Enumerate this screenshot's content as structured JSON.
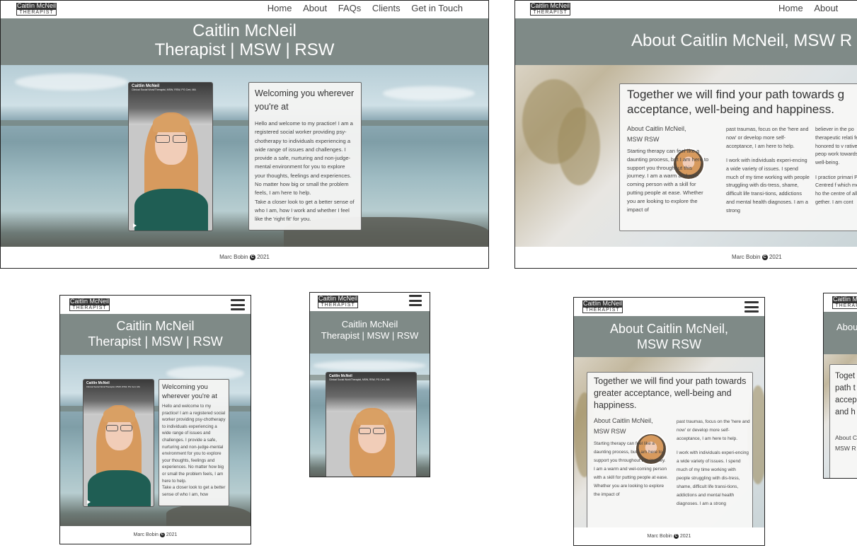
{
  "site": {
    "logo_line1": "Caitlin McNeil",
    "logo_line2": "THERAPIST",
    "footer_author": "Marc Bobin",
    "footer_year": "2021",
    "copyright_symbol": "C"
  },
  "nav": {
    "home": "Home",
    "about": "About",
    "faqs": "FAQs",
    "clients": "Clients",
    "contact": "Get in Touch"
  },
  "home": {
    "title_line1": "Caitlin McNeil",
    "title_line2": "Therapist | MSW | RSW",
    "video_name": "Caitlin McNeil",
    "video_subtitle": "Clinical Social Work/Therapist, MSW, RSW, PG Cert, MA",
    "welcome_heading": "Welcoming you wherever you're at",
    "welcome_p1": "Hello and welcome to my practice! I am a registered social worker providing psy-chotherapy to individuals experiencing a wide range of issues and challenges. I provide a safe, nurturing and non-judge-mental environment for you to explore your thoughts, feelings and experiences. No matter how big or small the problem feels, I am here to help.",
    "welcome_p2": "Take a closer look to get a better sense of who I am, how I work and whether I feel like the 'right fit' for you.",
    "welcome_p2_truncated": "Take a closer look to get a better sense of who I am, how"
  },
  "about": {
    "title_desktop": "About Caitlin McNeil, MSW R",
    "title_line1": "About Caitlin McNeil,",
    "title_line2": "MSW RSW",
    "title_partial": "Abou",
    "tagline_desktop_1": "Together we will find your path towards g",
    "tagline_desktop_2": "acceptance, well-being and happiness.",
    "tagline_full": "Together we will find your path towards greater acceptance, well-being and happiness.",
    "tagline_partial": "Toget path t accep and h",
    "subheading": "About Caitlin McNeil, MSW RSW",
    "subheading_partial": "About C MSW R",
    "col1": "Starting therapy can feel like a daunting process, but I am here to support you throughout this journey. I am a warm and wel-coming person with a skill for putting people at ease. Whether you are looking to explore the impact of",
    "col2_p1": "past traumas, focus on the 'here and now' or develop more self-acceptance, I am here to help.",
    "col2_p2": "I work with individuals experi-encing a wide variety of issues. I spend much of my time working with people struggling with dis-tress, shame, difficult life transi-tions, addictions and mental health diagnoses. I am a strong",
    "col3_p1": "believer in the po therapeutic relati feel honored to v ratively with peop work towards gre well-being.",
    "col3_p2": "I practice primari Person-Centred f which means I ho the centre of all c gether. I am cont"
  }
}
